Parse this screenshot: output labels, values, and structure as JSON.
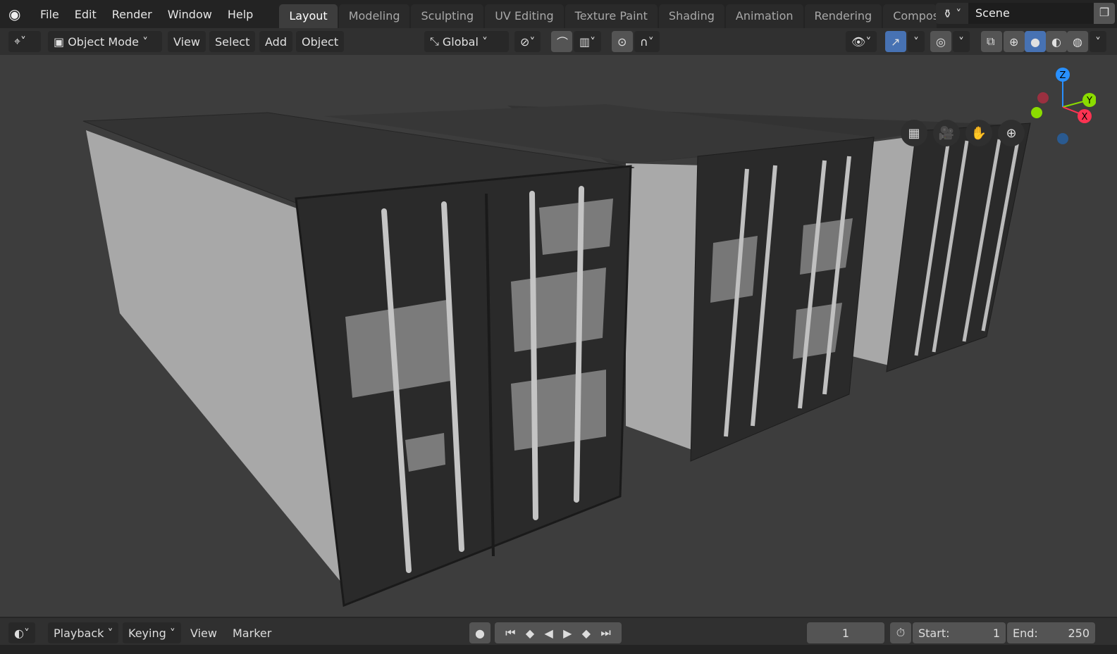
{
  "topbar": {
    "menus": [
      "File",
      "Edit",
      "Render",
      "Window",
      "Help"
    ],
    "workspaces": [
      "Layout",
      "Modeling",
      "Sculpting",
      "UV Editing",
      "Texture Paint",
      "Shading",
      "Animation",
      "Rendering",
      "Compos"
    ],
    "active_workspace": "Layout",
    "scene": "Scene"
  },
  "header": {
    "mode": "Object Mode",
    "menus": [
      "View",
      "Select",
      "Add",
      "Object"
    ],
    "orientation": "Global"
  },
  "gizmo": {
    "z": "Z",
    "y": "Y",
    "x": "X"
  },
  "timeline": {
    "menus": [
      "Playback",
      "Keying",
      "View",
      "Marker"
    ],
    "current_frame": "1",
    "start_label": "Start:",
    "start": "1",
    "end_label": "End:",
    "end": "250"
  },
  "colors": {
    "accent": "#4772b3",
    "x_axis": "#ff3352",
    "y_axis": "#8bdc00",
    "z_axis": "#2890ff"
  }
}
